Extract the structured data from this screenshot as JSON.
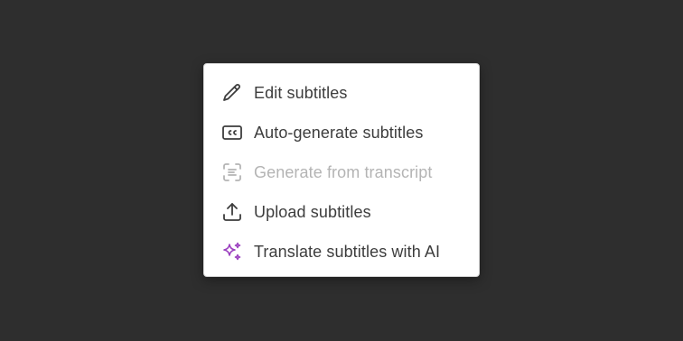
{
  "menu": {
    "items": [
      {
        "label": "Edit subtitles",
        "icon": "pencil-icon",
        "enabled": true
      },
      {
        "label": "Auto-generate subtitles",
        "icon": "closed-captions-icon",
        "enabled": true
      },
      {
        "label": "Generate from transcript",
        "icon": "transcript-scan-icon",
        "enabled": false
      },
      {
        "label": "Upload subtitles",
        "icon": "upload-icon",
        "enabled": true
      },
      {
        "label": "Translate subtitles with AI",
        "icon": "sparkles-icon",
        "enabled": true
      }
    ]
  },
  "colors": {
    "backdrop": "#2e2e2e",
    "menu_background": "#ffffff",
    "text": "#3d3d3d",
    "disabled_text": "#b4b4b4",
    "icon": "#3d3d3d",
    "ai_accent": "#9b3fbf"
  }
}
